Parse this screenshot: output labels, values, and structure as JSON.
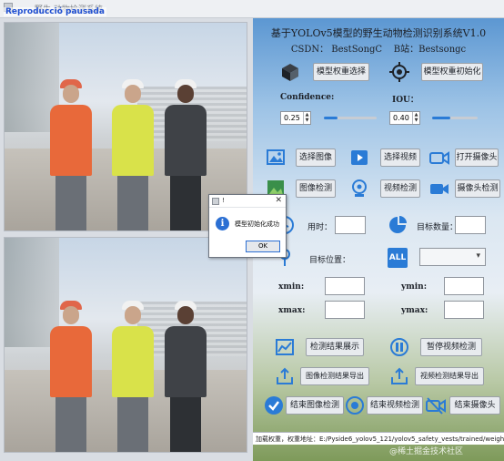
{
  "window": {
    "title": "野生 动物检测系统",
    "status_tag": "Reproducció pausada"
  },
  "header": {
    "title": "基于YOLOv5模型的野生动物检测识别系统V1.0",
    "csdn": "CSDN： BestSongC",
    "bili": "B站：Bestsongc"
  },
  "model": {
    "select_label": "模型权重选择",
    "init_label": "模型权重初始化"
  },
  "params": {
    "confidence_label": "Confidence:",
    "confidence_value": "0.25",
    "confidence_fraction": 0.25,
    "iou_label": "IOU：",
    "iou_value": "0.40",
    "iou_fraction": 0.4
  },
  "actions": {
    "select_image": "选择图像",
    "select_video": "选择视频",
    "open_camera": "打开摄像头",
    "image_detect": "图像检测",
    "video_detect": "视频检测",
    "camera_detect": "摄像头检测"
  },
  "results": {
    "time_label": "用时：",
    "count_label": "目标数量：",
    "position_label": "目标位置：",
    "all_text": "ALL",
    "xmin_label": "xmin:",
    "ymin_label": "ymin:",
    "xmax_label": "xmax:",
    "ymax_label": "ymax:"
  },
  "bottom_actions": {
    "show_results": "检测结果展示",
    "pause_video": "暂停视频检测",
    "export_image": "图像检测结果导出",
    "export_video": "视频检测结果导出",
    "end_image": "结束图像检测",
    "end_video": "结束视频检测",
    "end_camera": "结束摄像头"
  },
  "status_bar": {
    "text": "加载权重，权重地址：E:/Pyside6_yolov5_121/yolov5_safety_vests/trained/weights/best.pt"
  },
  "watermark": "@稀土掘金技术社区",
  "dialog": {
    "title": "!",
    "message": "模型初始化成功",
    "ok": "OK"
  },
  "colors": {
    "accent": "#2a7bd6",
    "vest_orange": "#e8693a",
    "vest_yellow": "#d9e24a",
    "helmet_white": "#f1f1f1"
  }
}
